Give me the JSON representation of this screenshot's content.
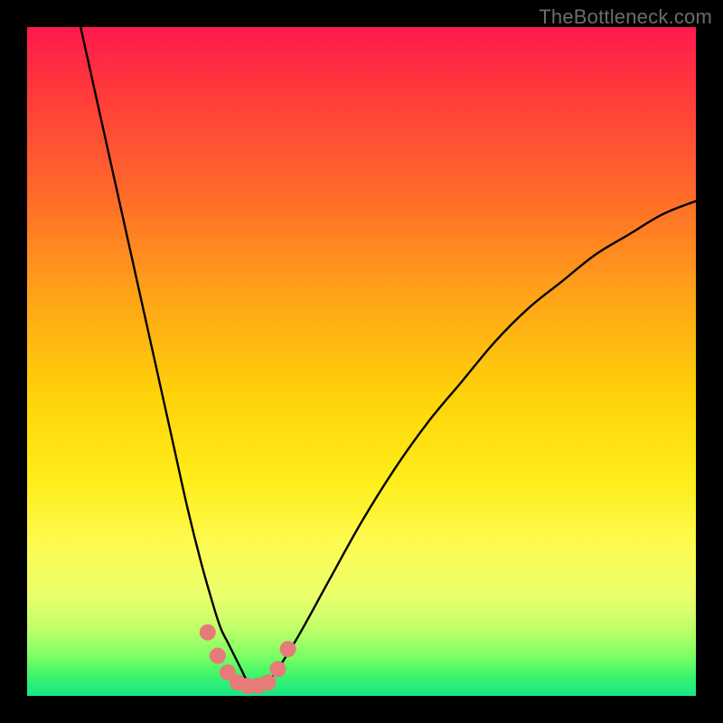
{
  "watermark": "TheBottleneck.com",
  "chart_data": {
    "type": "line",
    "title": "",
    "xlabel": "",
    "ylabel": "",
    "xlim": [
      0,
      100
    ],
    "ylim": [
      0,
      100
    ],
    "series": [
      {
        "name": "bottleneck-curve",
        "x": [
          8,
          10,
          12,
          14,
          16,
          18,
          20,
          22,
          24,
          26,
          28,
          29,
          30,
          31,
          32,
          33,
          34,
          36,
          40,
          45,
          50,
          55,
          60,
          65,
          70,
          75,
          80,
          85,
          90,
          95,
          100
        ],
        "y": [
          100,
          91,
          82,
          73,
          64,
          55,
          46,
          37,
          28,
          20,
          13,
          10,
          8,
          6,
          4,
          2,
          1,
          2,
          8,
          17,
          26,
          34,
          41,
          47,
          53,
          58,
          62,
          66,
          69,
          72,
          74
        ]
      },
      {
        "name": "marker-dots",
        "x": [
          27.0,
          28.5,
          30.0,
          31.5,
          33.0,
          34.5,
          36.0,
          37.5,
          39.0
        ],
        "y": [
          9.5,
          6.0,
          3.5,
          2.0,
          1.5,
          1.5,
          2.0,
          4.0,
          7.0
        ]
      }
    ]
  }
}
